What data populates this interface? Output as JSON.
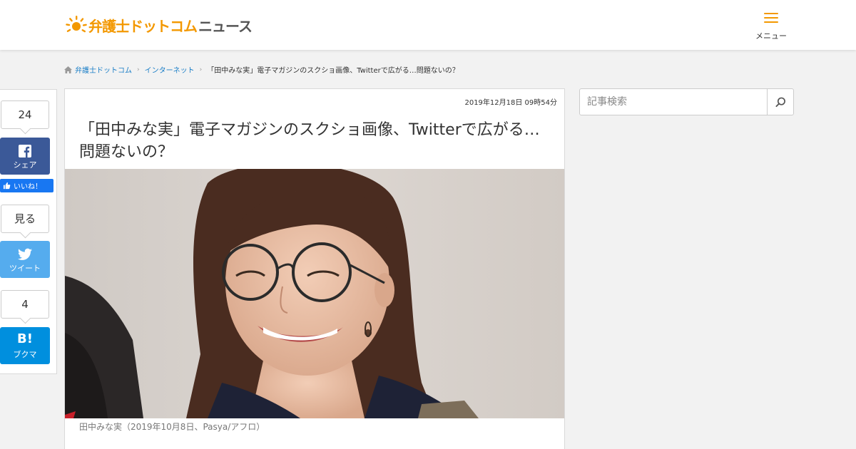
{
  "header": {
    "logo_text_primary": "弁護士ドットコム",
    "logo_text_secondary": "ニュース",
    "menu_label": "メニュー",
    "brand_color": "#f39800"
  },
  "breadcrumb": {
    "items": [
      "弁護士ドットコム",
      "インターネット"
    ],
    "current": "「田中みな実」電子マガジンのスクショ画像、Twitterで広がる…問題ないの？"
  },
  "share": {
    "facebook_count": "24",
    "facebook_label": "シェア",
    "like_label": "いいね！",
    "twitter_count": "見る",
    "twitter_label": "ツイート",
    "hatena_count": "4",
    "hatena_glyph": "B!",
    "hatena_label": "ブクマ",
    "colors": {
      "facebook": "#3b5998",
      "twitter": "#55acee",
      "hatena": "#008fde",
      "like": "#1877f2"
    }
  },
  "article": {
    "date": "2019年12月18日 09時54分",
    "title_line1": "「田中みな実」電子マガジンのスクショ画像、Twitterで広がる…",
    "title_line2": "問題ないの？",
    "caption": "田中みな実（2019年10月8日、Pasya/アフロ）"
  },
  "search": {
    "placeholder": "記事検索"
  }
}
